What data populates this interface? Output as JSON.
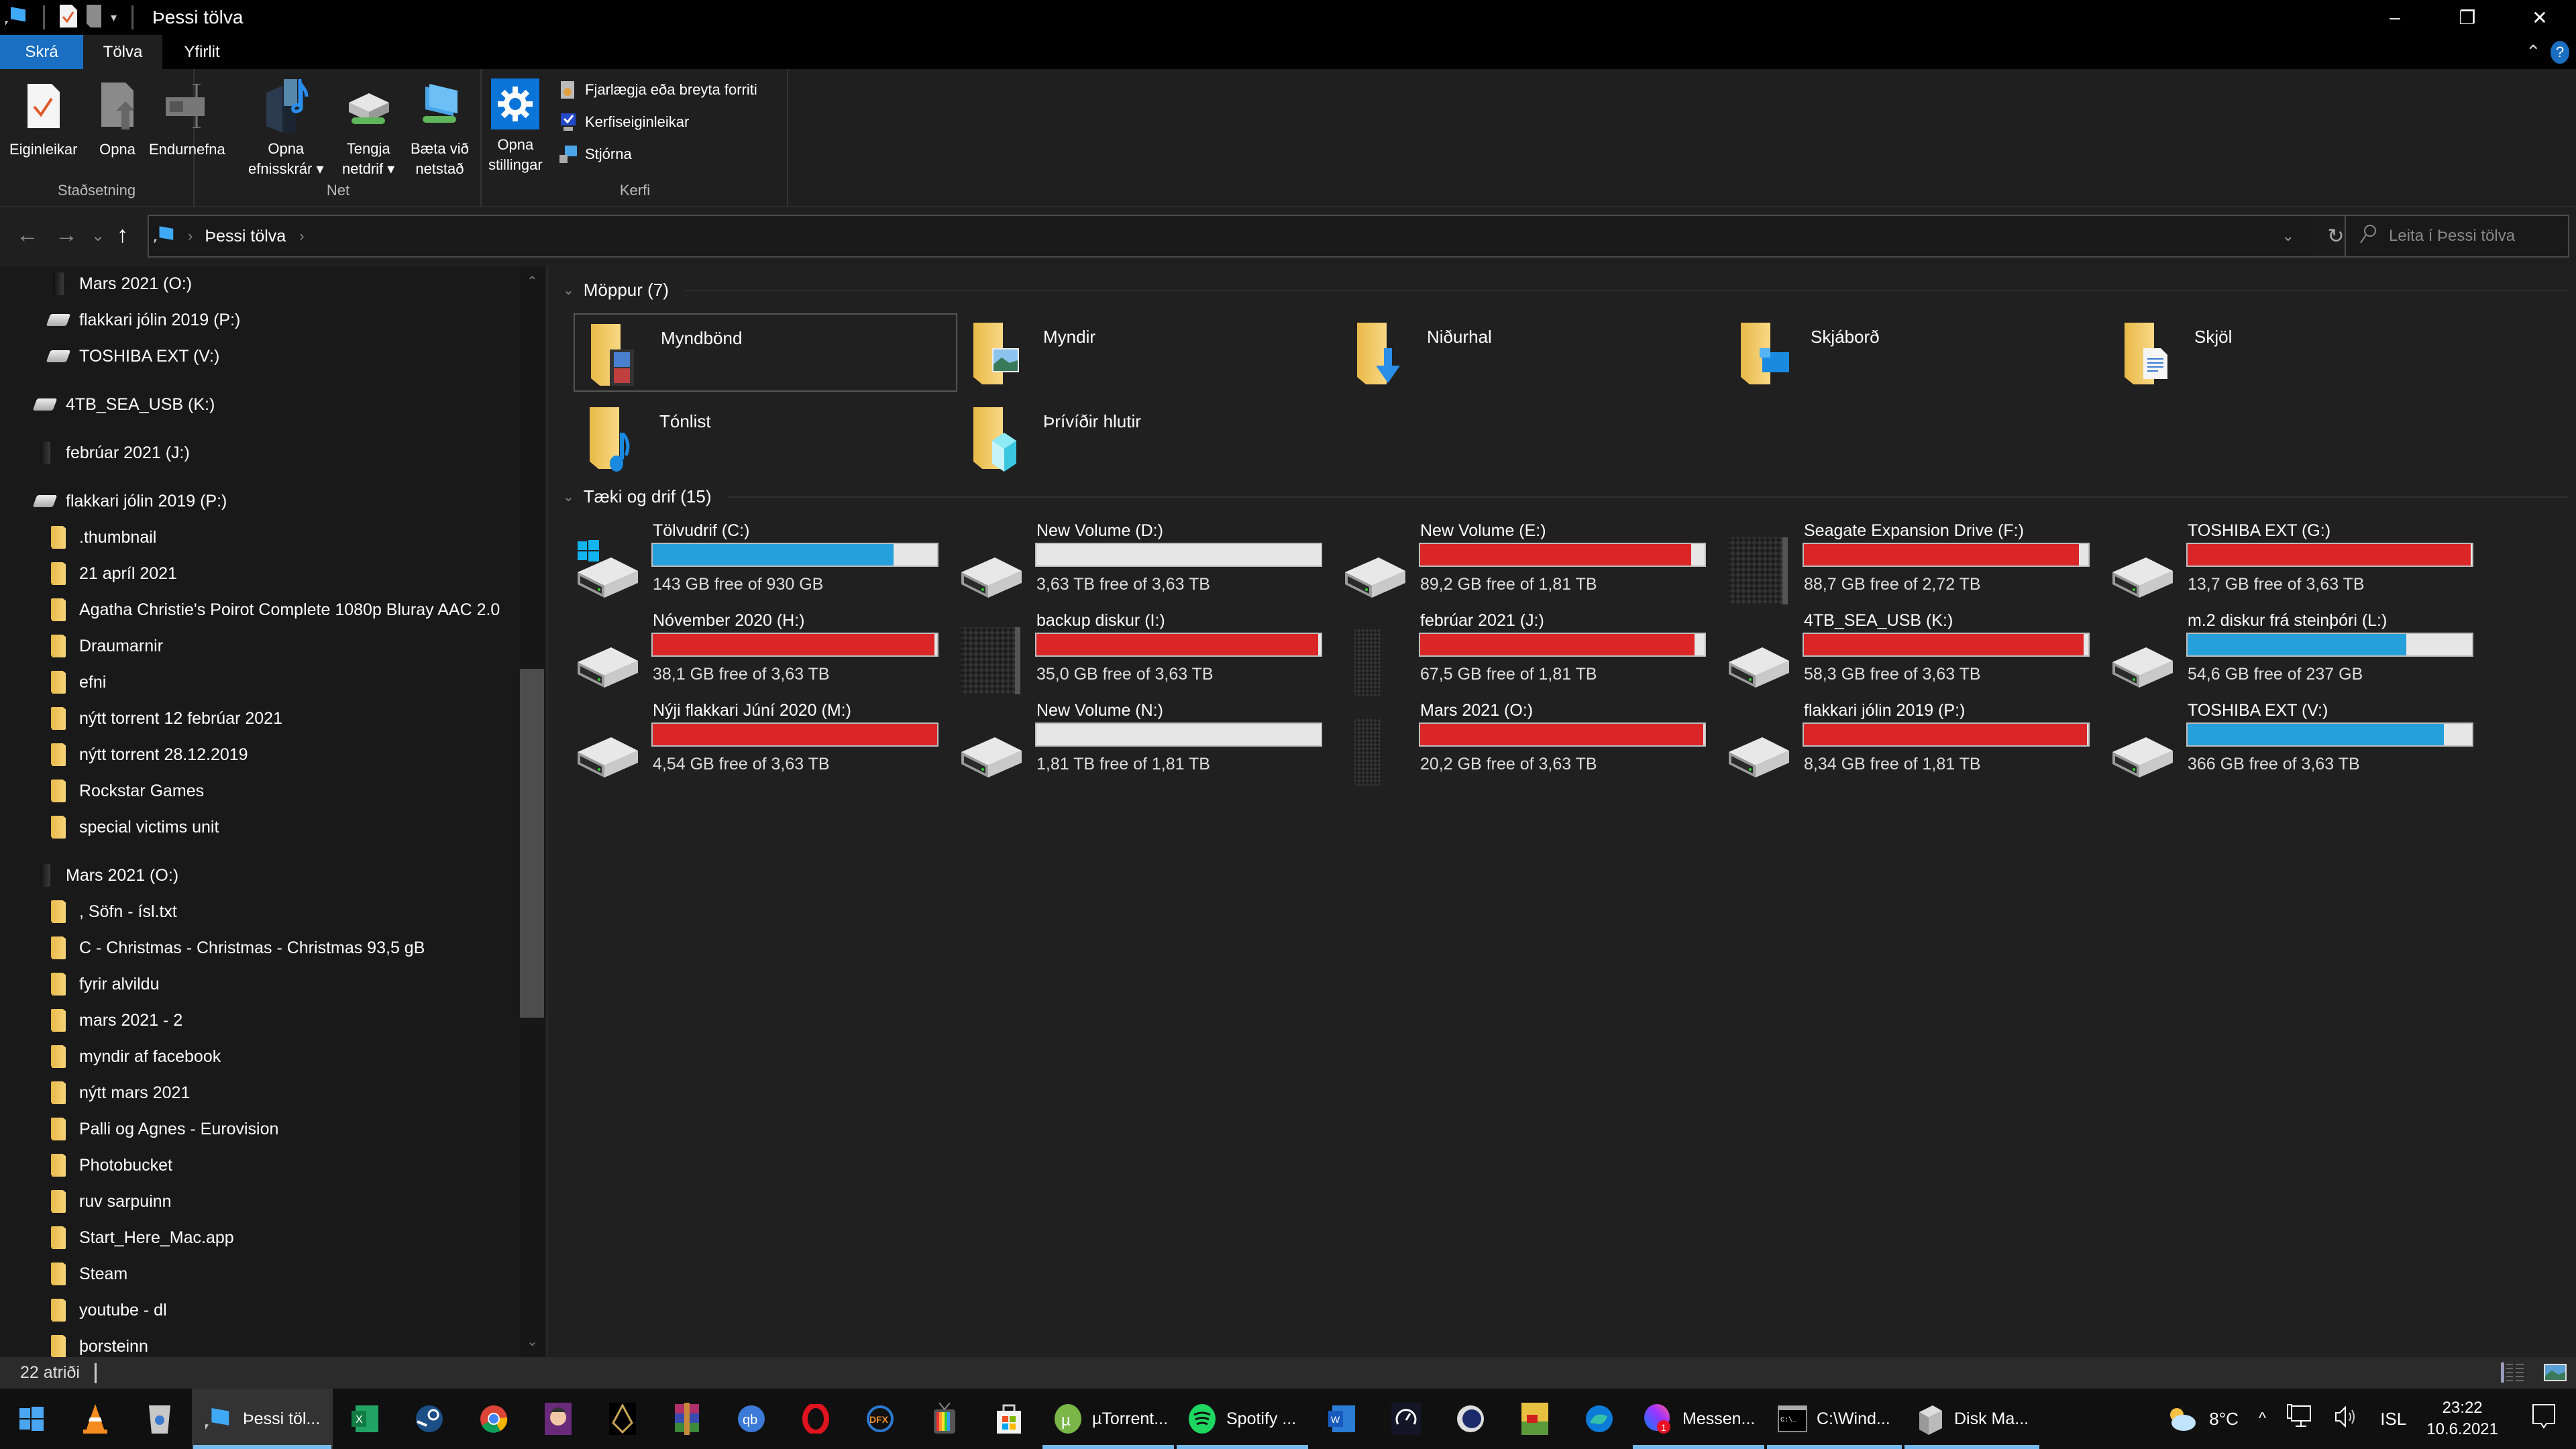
{
  "window": {
    "title": "Þessi tölva",
    "controls": {
      "minimize": "–",
      "maximize": "❐",
      "close": "✕"
    }
  },
  "ribbon": {
    "tabs": [
      {
        "label": "Skrá",
        "kind": "file"
      },
      {
        "label": "Tölva",
        "kind": "active"
      },
      {
        "label": "Yfirlit",
        "kind": "plain"
      }
    ],
    "collapse_icon": "chevron-up-icon",
    "help_label": "?",
    "groups": [
      {
        "label": "Staðsetning",
        "buttons": [
          {
            "label": "Eiginleikar",
            "icon": "properties-icon"
          },
          {
            "label": "Opna",
            "icon": "open-icon"
          },
          {
            "label": "Endurnefna",
            "icon": "rename-icon"
          }
        ]
      },
      {
        "label": "Net",
        "buttons": [
          {
            "label": "Opna\nefnisskrár ▾",
            "line1": "Opna",
            "line2": "efnisskrár ▾",
            "icon": "media-server-icon"
          },
          {
            "label": "Tengja\nnetdrif ▾",
            "line1": "Tengja",
            "line2": "netdrif ▾",
            "icon": "map-network-drive-icon"
          },
          {
            "label": "Bæta við\nnetstað",
            "line1": "Bæta við",
            "line2": "netstað",
            "icon": "add-network-location-icon"
          }
        ]
      },
      {
        "label": "Kerfi",
        "buttons": [
          {
            "label": "Opna\nstillingar",
            "line1": "Opna",
            "line2": "stillingar",
            "icon": "settings-gear-icon"
          }
        ],
        "small": [
          {
            "label": "Fjarlægja eða breyta forriti",
            "icon": "uninstall-program-icon"
          },
          {
            "label": "Kerfiseiginleikar",
            "icon": "system-properties-icon"
          },
          {
            "label": "Stjórna",
            "icon": "manage-icon"
          }
        ]
      }
    ]
  },
  "nav": {
    "back": "←",
    "forward": "→",
    "recent": "⌄",
    "up": "↑",
    "breadcrumb": [
      "Þessi tölva"
    ],
    "refresh": "↻",
    "dropdown": "⌄",
    "search_placeholder": "Leita í Þessi tölva"
  },
  "sidebar": {
    "items": [
      {
        "label": "Mars 2021 (O:)",
        "icon": "external-drive-icon",
        "level": 2
      },
      {
        "label": "flakkari jólin 2019 (P:)",
        "icon": "hard-drive-icon",
        "level": 2
      },
      {
        "label": "TOSHIBA EXT (V:)",
        "icon": "hard-drive-icon",
        "level": 2
      },
      {
        "label": "4TB_SEA_USB (K:)",
        "icon": "hard-drive-icon",
        "level": 1
      },
      {
        "label": "febrúar 2021 (J:)",
        "icon": "external-drive-icon",
        "level": 1
      },
      {
        "label": "flakkari jólin 2019 (P:)",
        "icon": "hard-drive-icon",
        "level": 1
      },
      {
        "label": ".thumbnail",
        "icon": "folder-icon",
        "level": 2
      },
      {
        "label": "21 apríl 2021",
        "icon": "folder-icon",
        "level": 2
      },
      {
        "label": "Agatha Christie's Poirot Complete 1080p Bluray AAC 2.0",
        "icon": "folder-icon",
        "level": 2
      },
      {
        "label": "Draumarnir",
        "icon": "folder-icon",
        "level": 2
      },
      {
        "label": "efni",
        "icon": "folder-icon",
        "level": 2
      },
      {
        "label": "nýtt torrent 12 febrúar 2021",
        "icon": "folder-icon",
        "level": 2
      },
      {
        "label": "nýtt torrent 28.12.2019",
        "icon": "folder-icon",
        "level": 2
      },
      {
        "label": "Rockstar Games",
        "icon": "folder-icon",
        "level": 2
      },
      {
        "label": "special victims unit",
        "icon": "folder-icon",
        "level": 2
      },
      {
        "label": "Mars 2021 (O:)",
        "icon": "external-drive-icon",
        "level": 1
      },
      {
        "label": ", Söfn - ísl.txt",
        "icon": "folder-icon",
        "level": 2
      },
      {
        "label": "C - Christmas - Christmas - Christmas 93,5 gB",
        "icon": "folder-icon",
        "level": 2
      },
      {
        "label": "fyrir alvildu",
        "icon": "folder-icon",
        "level": 2
      },
      {
        "label": "mars 2021 - 2",
        "icon": "folder-icon",
        "level": 2
      },
      {
        "label": "myndir af facebook",
        "icon": "folder-icon",
        "level": 2
      },
      {
        "label": "nýtt mars 2021",
        "icon": "folder-icon",
        "level": 2
      },
      {
        "label": "Palli og Agnes - Eurovision",
        "icon": "folder-icon",
        "level": 2
      },
      {
        "label": "Photobucket",
        "icon": "folder-icon",
        "level": 2
      },
      {
        "label": "ruv sarpuinn",
        "icon": "folder-icon",
        "level": 2
      },
      {
        "label": "Start_Here_Mac.app",
        "icon": "folder-icon",
        "level": 2
      },
      {
        "label": "Steam",
        "icon": "folder-icon",
        "level": 2
      },
      {
        "label": "youtube - dl",
        "icon": "folder-icon",
        "level": 2
      },
      {
        "label": "þorsteinn",
        "icon": "folder-icon",
        "level": 2
      }
    ]
  },
  "content": {
    "folders_header": "Möppur (7)",
    "folders": [
      {
        "label": "Myndbönd",
        "icon": "videos-folder-icon",
        "selected": true
      },
      {
        "label": "Myndir",
        "icon": "pictures-folder-icon"
      },
      {
        "label": "Niðurhal",
        "icon": "downloads-folder-icon"
      },
      {
        "label": "Skjáborð",
        "icon": "desktop-folder-icon"
      },
      {
        "label": "Skjöl",
        "icon": "documents-folder-icon"
      },
      {
        "label": "Tónlist",
        "icon": "music-folder-icon"
      },
      {
        "label": "Þrívíðir hlutir",
        "icon": "3d-objects-folder-icon"
      }
    ],
    "drives_header": "Tæki og drif (15)",
    "drives": [
      {
        "name": "Tölvudrif (C:)",
        "free": "143 GB free of 930 GB",
        "used_fraction": 0.846,
        "status": "normal",
        "icon": "windows-drive-icon"
      },
      {
        "name": "New Volume (D:)",
        "free": "3,63 TB free of 3,63 TB",
        "used_fraction": 0.0,
        "status": "normal",
        "icon": "hard-drive-icon"
      },
      {
        "name": "New Volume (E:)",
        "free": "89,2 GB free of 1,81 TB",
        "used_fraction": 0.952,
        "status": "full",
        "icon": "hard-drive-icon"
      },
      {
        "name": "Seagate Expansion Drive (F:)",
        "free": "88,7 GB free of 2,72 TB",
        "used_fraction": 0.968,
        "status": "full",
        "icon": "external-drive-icon"
      },
      {
        "name": "TOSHIBA EXT (G:)",
        "free": "13,7 GB free of 3,63 TB",
        "used_fraction": 0.996,
        "status": "full",
        "icon": "hard-drive-icon"
      },
      {
        "name": "Nóvember 2020 (H:)",
        "free": "38,1 GB free of 3,63 TB",
        "used_fraction": 0.99,
        "status": "full",
        "icon": "hard-drive-icon"
      },
      {
        "name": "backup diskur (I:)",
        "free": "35,0 GB free of 3,63 TB",
        "used_fraction": 0.991,
        "status": "full",
        "icon": "external-drive-icon"
      },
      {
        "name": "febrúar 2021 (J:)",
        "free": "67,5 GB free of 1,81 TB",
        "used_fraction": 0.964,
        "status": "full",
        "icon": "external-drive-icon"
      },
      {
        "name": "4TB_SEA_USB (K:)",
        "free": "58,3 GB free of 3,63 TB",
        "used_fraction": 0.984,
        "status": "full",
        "icon": "hard-drive-icon"
      },
      {
        "name": "m.2 diskur frá steinþóri (L:)",
        "free": "54,6 GB free of 237 GB",
        "used_fraction": 0.77,
        "status": "normal",
        "icon": "hard-drive-icon"
      },
      {
        "name": "Nýji flakkari Júní 2020 (M:)",
        "free": "4,54 GB free of 3,63 TB",
        "used_fraction": 0.999,
        "status": "full",
        "icon": "hard-drive-icon"
      },
      {
        "name": "New Volume (N:)",
        "free": "1,81 TB free of 1,81 TB",
        "used_fraction": 0.0,
        "status": "normal",
        "icon": "hard-drive-icon"
      },
      {
        "name": "Mars 2021 (O:)",
        "free": "20,2 GB free of 3,63 TB",
        "used_fraction": 0.995,
        "status": "full",
        "icon": "external-drive-icon"
      },
      {
        "name": "flakkari jólin 2019 (P:)",
        "free": "8,34 GB free of 1,81 TB",
        "used_fraction": 0.996,
        "status": "full",
        "icon": "hard-drive-icon"
      },
      {
        "name": "TOSHIBA EXT (V:)",
        "free": "366 GB free of 3,63 TB",
        "used_fraction": 0.902,
        "status": "normal",
        "icon": "hard-drive-icon"
      }
    ],
    "colors": {
      "normal": "#26a0da",
      "full": "#da2626",
      "empty": "#e6e6e6"
    }
  },
  "statusbar": {
    "count": "22 atriði"
  },
  "taskbar": {
    "apps": [
      {
        "name": "start",
        "icon": "windows-start-icon"
      },
      {
        "name": "vlc",
        "icon": "vlc-icon"
      },
      {
        "name": "recycle-bin",
        "icon": "recycle-bin-icon"
      },
      {
        "name": "file-explorer",
        "icon": "this-pc-icon",
        "label": "Þessi töl...",
        "running": true,
        "active": true
      },
      {
        "name": "excel",
        "icon": "excel-icon"
      },
      {
        "name": "steam",
        "icon": "steam-icon"
      },
      {
        "name": "chrome",
        "icon": "chrome-icon"
      },
      {
        "name": "game-character",
        "icon": "game-character-icon"
      },
      {
        "name": "game-emblem",
        "icon": "game-emblem-icon"
      },
      {
        "name": "winrar",
        "icon": "winrar-icon"
      },
      {
        "name": "qbittorrent",
        "icon": "qbittorrent-icon"
      },
      {
        "name": "opera",
        "icon": "opera-icon"
      },
      {
        "name": "dfx",
        "icon": "dfx-icon"
      },
      {
        "name": "tv-app",
        "icon": "retro-tv-icon"
      },
      {
        "name": "store",
        "icon": "microsoft-store-icon"
      },
      {
        "name": "utorrent",
        "icon": "utorrent-icon",
        "label": "µTorrent...",
        "running": true
      },
      {
        "name": "spotify",
        "icon": "spotify-icon",
        "label": "Spotify ...",
        "running": true
      },
      {
        "name": "word",
        "icon": "word-icon"
      },
      {
        "name": "speedtest",
        "icon": "speedtest-icon"
      },
      {
        "name": "cinema4d",
        "icon": "cinema4d-icon"
      },
      {
        "name": "farm-game",
        "icon": "farm-game-icon"
      },
      {
        "name": "edge",
        "icon": "edge-icon"
      },
      {
        "name": "messenger",
        "icon": "messenger-icon",
        "label": "Messen...",
        "running": true,
        "badge": "1"
      },
      {
        "name": "cmd",
        "icon": "command-prompt-icon",
        "label": "C:\\Wind...",
        "running": true
      },
      {
        "name": "disk-management",
        "icon": "disk-management-icon",
        "label": "Disk Ma...",
        "running": true
      }
    ],
    "tray": {
      "weather": "8°C",
      "overflow": "^",
      "language": "ISL",
      "time": "23:22",
      "date": "10.6.2021"
    }
  }
}
